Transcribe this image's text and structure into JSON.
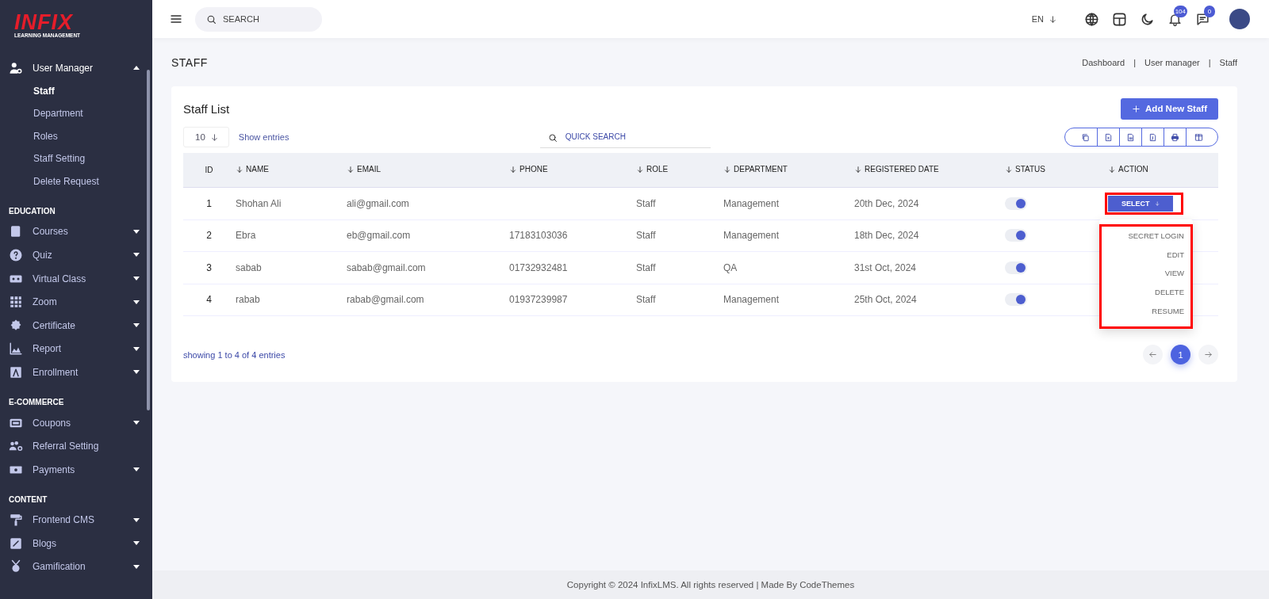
{
  "logo": {
    "brand": "INFIX",
    "tagline": "LEARNING MANAGEMENT"
  },
  "sidebar": {
    "sections": [
      {
        "items": [
          {
            "label": "User Manager",
            "kind": "dropdown",
            "expanded": true,
            "children": [
              {
                "label": "Staff",
                "selected": true
              },
              {
                "label": "Department",
                "selected": false
              },
              {
                "label": "Roles",
                "selected": false
              },
              {
                "label": "Staff Setting",
                "selected": false
              },
              {
                "label": "Delete Request",
                "selected": false
              }
            ]
          }
        ]
      },
      {
        "heading": "EDUCATION",
        "items": [
          {
            "label": "Courses",
            "kind": "dropdown",
            "expanded": false
          },
          {
            "label": "Quiz",
            "kind": "dropdown",
            "expanded": false
          },
          {
            "label": "Virtual Class",
            "kind": "dropdown",
            "expanded": false
          },
          {
            "label": "Zoom",
            "kind": "dropdown",
            "expanded": false
          },
          {
            "label": "Certificate",
            "kind": "dropdown",
            "expanded": false
          },
          {
            "label": "Report",
            "kind": "dropdown",
            "expanded": false
          },
          {
            "label": "Enrollment",
            "kind": "dropdown",
            "expanded": false
          }
        ]
      },
      {
        "heading": "E-COMMERCE",
        "items": [
          {
            "label": "Coupons",
            "kind": "dropdown",
            "expanded": false
          },
          {
            "label": "Referral Setting",
            "kind": "link",
            "expanded": false
          },
          {
            "label": "Payments",
            "kind": "dropdown",
            "expanded": false
          }
        ]
      },
      {
        "heading": "CONTENT",
        "items": [
          {
            "label": "Frontend CMS",
            "kind": "dropdown",
            "expanded": false
          },
          {
            "label": "Blogs",
            "kind": "dropdown",
            "expanded": false
          },
          {
            "label": "Gamification",
            "kind": "dropdown",
            "expanded": false
          }
        ]
      }
    ]
  },
  "topbar": {
    "search": {
      "placeholder": "SEARCH"
    },
    "language": "EN",
    "notifications": "104",
    "messages": "0"
  },
  "page": {
    "title": "STAFF",
    "breadcrumb": {
      "items": [
        "Dashboard",
        "User manager",
        "Staff"
      ],
      "separator": "|"
    }
  },
  "card": {
    "title": "Staff List",
    "add_button": "Add New Staff",
    "page_size": "10",
    "show_entries": "Show entries",
    "quick_search": {
      "placeholder": "QUICK SEARCH"
    },
    "table": {
      "columns": [
        {
          "label": "ID",
          "sortable": false
        },
        {
          "label": "NAME",
          "sortable": true
        },
        {
          "label": "EMAIL",
          "sortable": true
        },
        {
          "label": "PHONE",
          "sortable": true
        },
        {
          "label": "ROLE",
          "sortable": true
        },
        {
          "label": "DEPARTMENT",
          "sortable": true
        },
        {
          "label": "REGISTERED DATE",
          "sortable": true
        },
        {
          "label": "STATUS",
          "sortable": true
        },
        {
          "label": "ACTION",
          "sortable": true
        }
      ],
      "rows": [
        {
          "id": "1",
          "name": "Shohan Ali",
          "email": "ali@gmail.com",
          "role": "Staff",
          "department": "Management",
          "registered_date": "20th Dec, 2024",
          "status": true,
          "action": "SELECT"
        },
        {
          "id": "2",
          "name": "Ebra",
          "email": "eb@gmail.com",
          "phone": "17183103036",
          "role": "Staff",
          "department": "Management",
          "registered_date": "18th Dec, 2024",
          "status": true
        },
        {
          "id": "3",
          "name": "sabab",
          "email": "sabab@gmail.com",
          "phone": "01732932481",
          "role": "Staff",
          "department": "QA",
          "registered_date": "31st Oct, 2024",
          "status": true
        },
        {
          "id": "4",
          "name": "rabab",
          "email": "rabab@gmail.com",
          "phone": "01937239987",
          "role": "Staff",
          "department": "Management",
          "registered_date": "25th Oct, 2024",
          "status": true
        }
      ]
    },
    "action_menu": {
      "items": [
        "SECRET LOGIN",
        "EDIT",
        "VIEW",
        "DELETE",
        "RESUME"
      ],
      "highlighted": true
    },
    "select_highlighted": true,
    "summary": "showing 1 to 4 of 4 entries",
    "pages": [
      {
        "label": "1",
        "selected": true
      }
    ]
  },
  "footer": "Copyright © 2024 InfixLMS. All rights reserved | Made By CodeThemes"
}
